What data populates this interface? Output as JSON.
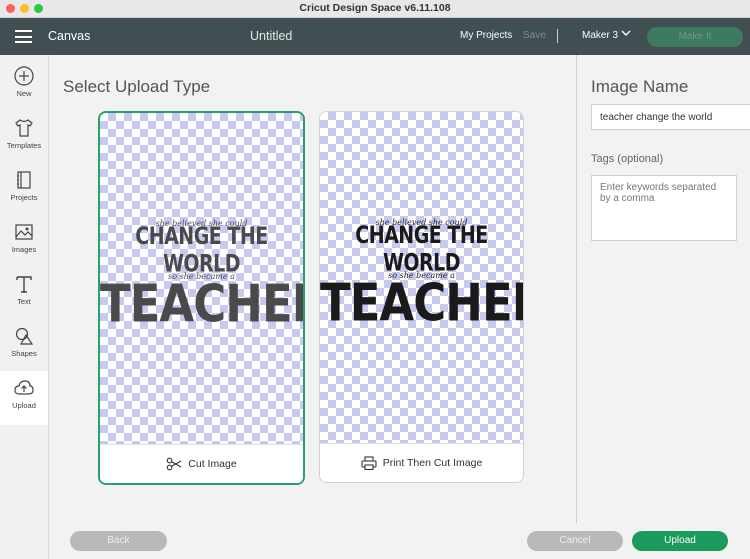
{
  "window": {
    "title": "Cricut Design Space  v6.11.108"
  },
  "appbar": {
    "canvas_label": "Canvas",
    "document_title": "Untitled",
    "my_projects": "My Projects",
    "save": "Save",
    "machine": "Maker 3",
    "make_it": "Make It"
  },
  "sidebar": {
    "items": [
      {
        "label": "New",
        "icon": "plus-circle-icon"
      },
      {
        "label": "Templates",
        "icon": "shirt-icon"
      },
      {
        "label": "Projects",
        "icon": "notebook-icon"
      },
      {
        "label": "Images",
        "icon": "image-icon"
      },
      {
        "label": "Text",
        "icon": "text-icon"
      },
      {
        "label": "Shapes",
        "icon": "shapes-icon"
      },
      {
        "label": "Upload",
        "icon": "cloud-upload-icon"
      }
    ]
  },
  "main": {
    "heading": "Select Upload Type",
    "cards": [
      {
        "label": "Cut Image",
        "icon": "scissors-icon",
        "selected": true,
        "art_color": "#4a4a4a"
      },
      {
        "label": "Print Then Cut Image",
        "icon": "printer-icon",
        "selected": false,
        "art_color": "#1a1a1a"
      }
    ],
    "artwork": {
      "line1": "she believed she could",
      "line2": "CHANGE THE WORLD",
      "line3": "so she became a",
      "line4": "TEACHER"
    }
  },
  "details": {
    "image_name_heading": "Image Name",
    "image_name_value": "teacher change the world",
    "tags_heading": "Tags (optional)",
    "tags_placeholder": "Enter keywords separated by a comma"
  },
  "footer": {
    "back": "Back",
    "cancel": "Cancel",
    "upload": "Upload"
  },
  "colors": {
    "accent": "#1b9a5e",
    "appbar": "#414f53",
    "checker": "#c7c9ee"
  }
}
